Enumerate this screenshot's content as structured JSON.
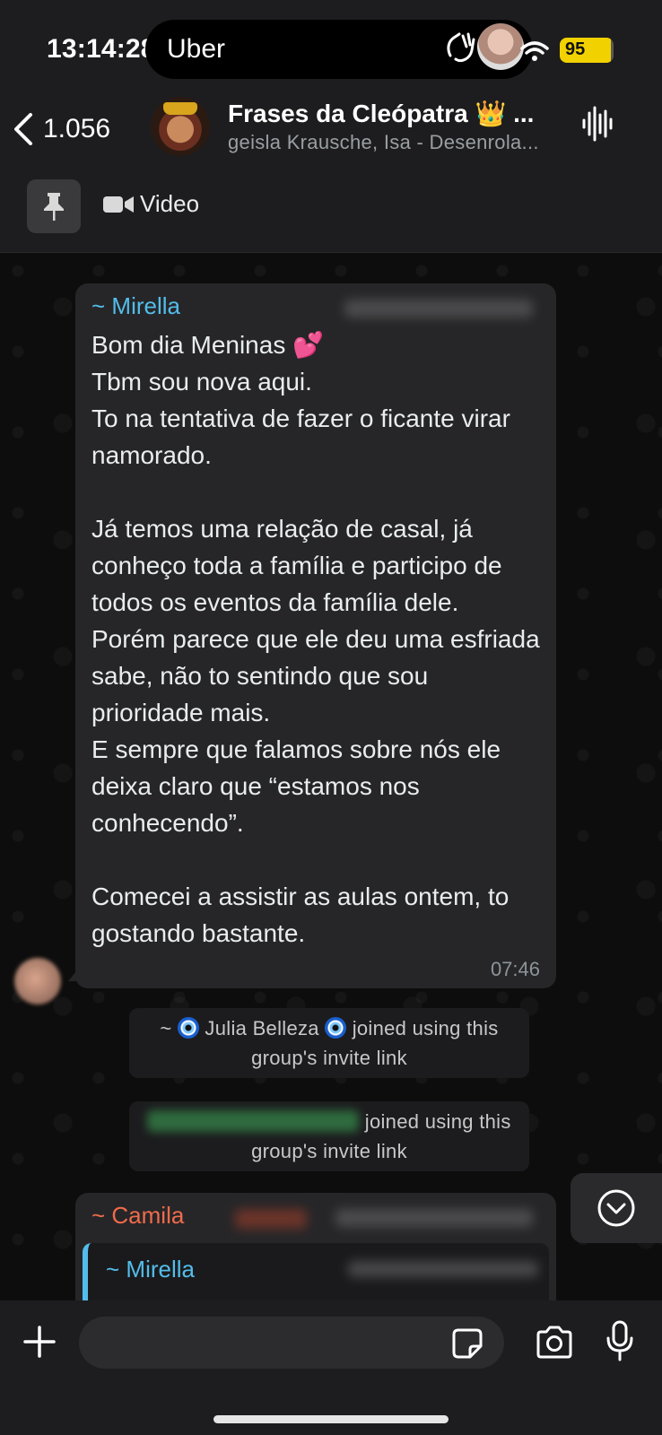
{
  "status_bar": {
    "time": "13:14:28",
    "app": "Uber",
    "battery": "95",
    "battery_level": 0.95
  },
  "header": {
    "back_count": "1.056",
    "title": "Frases da Cleópatra 👑 ...",
    "subtitle": "geisla Krausche, Isa - Desenrola...",
    "pinned_video_label": "Video"
  },
  "messages": {
    "first": {
      "sender": "~ Mirella",
      "text": "Bom dia Meninas 💕\nTbm sou nova aqui.\nTo na tentativa de fazer o ficante virar namorado.\n\nJá temos uma relação de casal, já conheço toda a família e participo de todos os eventos da família dele.\nPorém parece que ele deu uma esfriada sabe, não to sentindo que sou prioridade mais.\nE sempre que falamos sobre nós ele deixa claro que “estamos nos conhecendo”.\n\nComecei a assistir as aulas ontem, to gostando bastante.",
      "time": "07:46"
    },
    "system_1": {
      "prefix": "~",
      "name": "Julia Belleza",
      "suffix": "joined using this",
      "line2": "group's invite link"
    },
    "system_2": {
      "suffix": "joined using this",
      "line2": "group's invite link"
    },
    "second": {
      "sender": "~ Camila",
      "quote_sender": "~ Mirella"
    }
  },
  "icons": {
    "back": "chevron-left-icon",
    "voice": "waveform-icon",
    "pin": "pin-icon",
    "video": "video-camera-icon",
    "scroll_down": "chevron-down-circle-icon",
    "plus": "plus-icon",
    "sticker": "sticker-icon",
    "camera": "camera-icon",
    "mic": "microphone-icon"
  },
  "colors": {
    "accent_blue": "#53bdeb",
    "camila_orange": "#f06b4c",
    "bubble": "#262628",
    "battery": "#f2d100"
  }
}
